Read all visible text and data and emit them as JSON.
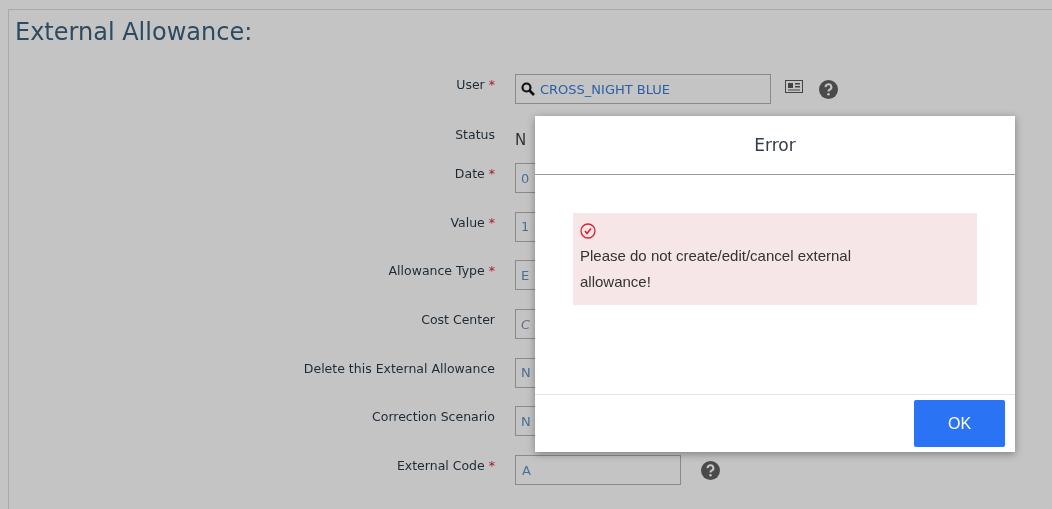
{
  "page": {
    "title": "External Allowance:"
  },
  "fields": [
    {
      "label": "User",
      "required_mark": "*",
      "kind": "lookup",
      "value": "CROSS_NIGHT BLUE",
      "help": true
    },
    {
      "label": "Status",
      "kind": "static",
      "value": "N"
    },
    {
      "label": "Date",
      "required_mark": "*",
      "kind": "clipped",
      "value": "0"
    },
    {
      "label": "Value",
      "required_mark": "*",
      "kind": "clipped",
      "value": "1"
    },
    {
      "label": "Allowance Type",
      "required_mark": "*",
      "kind": "clipped",
      "value": "E"
    },
    {
      "label": "Cost Center",
      "kind": "clipped",
      "placeholder": "C"
    },
    {
      "label": "Delete this External Allowance",
      "kind": "clipped",
      "value": "N"
    },
    {
      "label": "Correction Scenario",
      "kind": "clipped",
      "value": "N"
    },
    {
      "label": "External Code",
      "required_mark": "*",
      "kind": "text",
      "value": "A",
      "help": true
    }
  ],
  "dialog": {
    "title": "Error",
    "message": "Please do not create/edit/cancel external allowance!",
    "button": "OK"
  }
}
